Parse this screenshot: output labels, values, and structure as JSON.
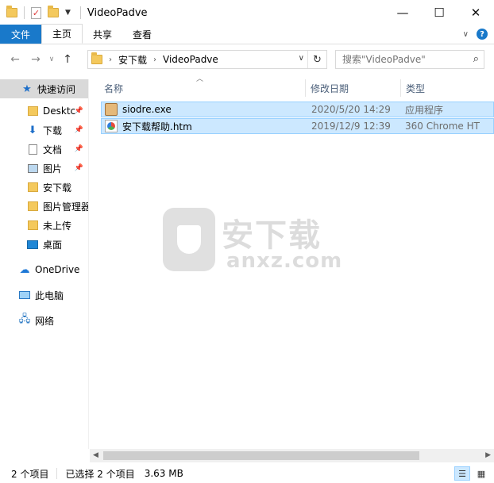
{
  "window": {
    "title": "VideoPadve"
  },
  "icons": {
    "minimize": "minimize-icon",
    "maximize": "maximize-icon",
    "close": "close-icon"
  },
  "ribbon": {
    "tabs": [
      "文件",
      "主页",
      "共享",
      "查看"
    ],
    "help": "?"
  },
  "address": {
    "crumbs": [
      "安下载",
      "VideoPadve"
    ]
  },
  "search": {
    "placeholder": "搜索\"VideoPadve\""
  },
  "sidebar": {
    "quick_access": "快速访问",
    "items": [
      {
        "label": "Desktc",
        "pinned": true
      },
      {
        "label": "下载",
        "pinned": true
      },
      {
        "label": "文档",
        "pinned": true
      },
      {
        "label": "图片",
        "pinned": true
      },
      {
        "label": "安下载",
        "pinned": false
      },
      {
        "label": "图片管理器",
        "pinned": false
      },
      {
        "label": "未上传",
        "pinned": false
      },
      {
        "label": "桌面",
        "pinned": false
      }
    ],
    "onedrive": "OneDrive",
    "this_pc": "此电脑",
    "network": "网络"
  },
  "columns": {
    "name": "名称",
    "date": "修改日期",
    "type": "类型"
  },
  "files": [
    {
      "name": "siodre.exe",
      "date": "2020/5/20 14:29",
      "type": "应用程序",
      "icon": "exe-icon"
    },
    {
      "name": "安下载帮助.htm",
      "date": "2019/12/9 12:39",
      "type": "360 Chrome HT",
      "icon": "html-file-icon"
    }
  ],
  "watermark": {
    "main": "安下载",
    "sub": "anxz.com"
  },
  "status": {
    "count": "2 个项目",
    "selected": "已选择 2 个项目",
    "size": "3.63 MB"
  }
}
